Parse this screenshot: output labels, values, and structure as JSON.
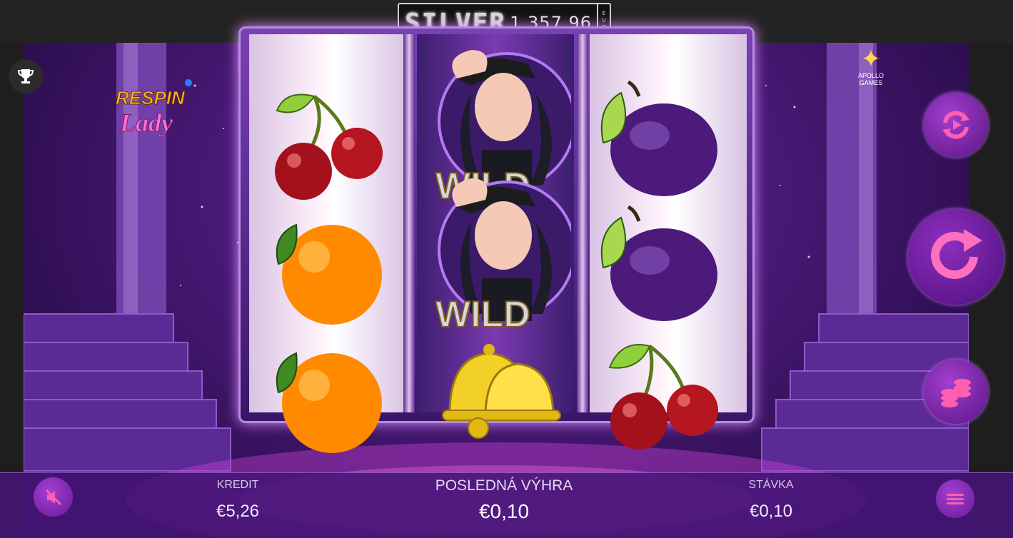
{
  "jackpot": {
    "tier": "SILVER",
    "amount": "1 357.96",
    "currency_letters": [
      "E",
      "U",
      "R"
    ]
  },
  "brand": {
    "game_logo_line1": "RESPIN",
    "game_logo_line2": "Lady",
    "provider_name": "APOLLO",
    "provider_sub": "GAMES"
  },
  "reels": [
    [
      "cherry-icon",
      "orange-icon",
      "orange-icon"
    ],
    [
      "wild-lady-icon",
      "wild-lady-icon",
      "bell-icon"
    ],
    [
      "plum-icon",
      "plum-icon",
      "cherry-icon"
    ]
  ],
  "wild_text": "WILD",
  "bottom": {
    "credit_label": "KREDIT",
    "credit_value": "€5,26",
    "last_win_label": "POSLEDNÁ VÝHRA",
    "last_win_value": "€0,10",
    "bet_label": "STÁVKA",
    "bet_value": "€0,10"
  },
  "colors": {
    "accent_pink": "#ff5fb0",
    "button_purple": "#a23fd0",
    "bar_purple": "#46167a"
  }
}
